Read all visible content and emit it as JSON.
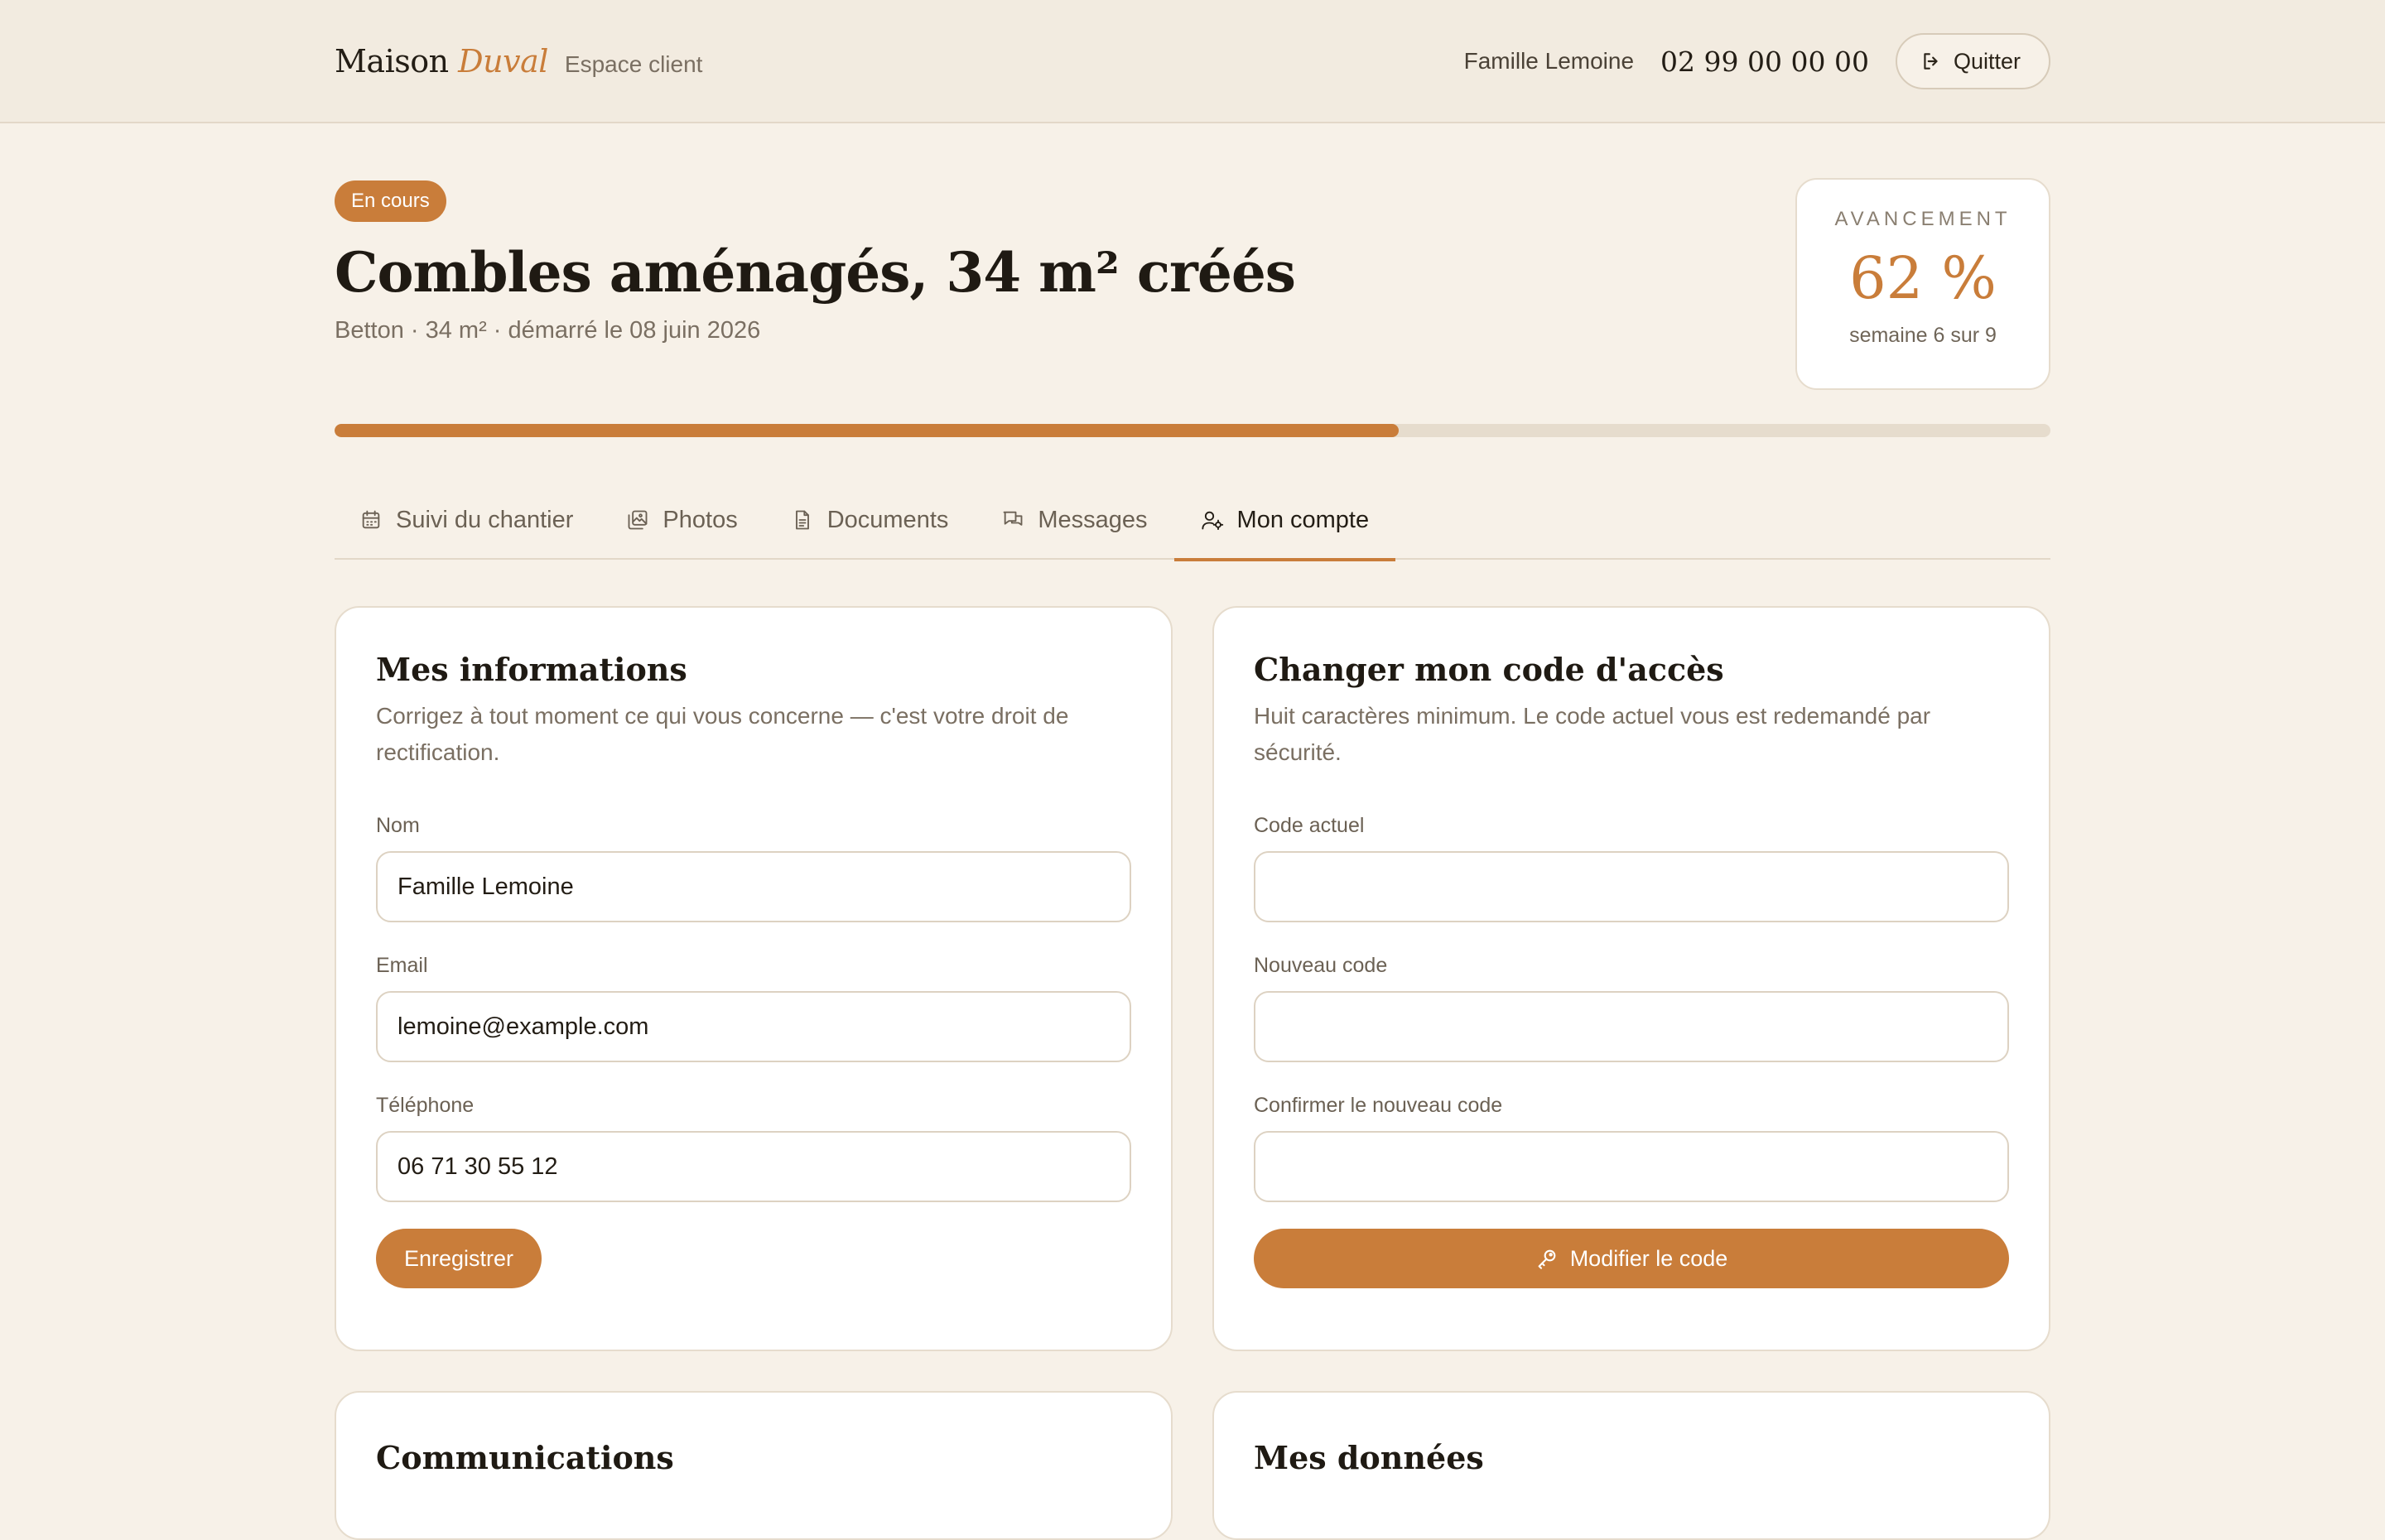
{
  "header": {
    "brand_main": "Maison",
    "brand_accent": "Duval",
    "brand_sub": "Espace client",
    "user_name": "Famille Lemoine",
    "phone": "02 99 00 00 00",
    "quit_label": "Quitter"
  },
  "project": {
    "status_badge": "En cours",
    "title": "Combles aménagés, 34 m² créés",
    "meta": "Betton · 34 m² · démarré le 08 juin 2026",
    "progress_label": "AVANCEMENT",
    "progress_value": "62 %",
    "progress_fraction": 0.62,
    "week_text": "semaine 6 sur 9"
  },
  "tabs": [
    {
      "label": "Suivi du chantier",
      "icon": "calendar-icon",
      "active": false
    },
    {
      "label": "Photos",
      "icon": "photos-icon",
      "active": false
    },
    {
      "label": "Documents",
      "icon": "document-icon",
      "active": false
    },
    {
      "label": "Messages",
      "icon": "messages-icon",
      "active": false
    },
    {
      "label": "Mon compte",
      "icon": "user-settings-icon",
      "active": true
    }
  ],
  "info_card": {
    "title": "Mes informations",
    "description": "Corrigez à tout moment ce qui vous concerne — c'est votre droit de rectification.",
    "name_label": "Nom",
    "name_value": "Famille Lemoine",
    "email_label": "Email",
    "email_value": "lemoine@example.com",
    "phone_label": "Téléphone",
    "phone_value": "06 71 30 55 12",
    "save_label": "Enregistrer"
  },
  "code_card": {
    "title": "Changer mon code d'accès",
    "description": "Huit caractères minimum. Le code actuel vous est redemandé par sécurité.",
    "current_label": "Code actuel",
    "new_label": "Nouveau code",
    "confirm_label": "Confirmer le nouveau code",
    "submit_label": "Modifier le code"
  },
  "comm_card": {
    "title": "Communications"
  },
  "data_card": {
    "title": "Mes données"
  },
  "colors": {
    "accent": "#c97d3a",
    "background": "#f7f1e8",
    "header_bg": "#f2ebe0"
  }
}
